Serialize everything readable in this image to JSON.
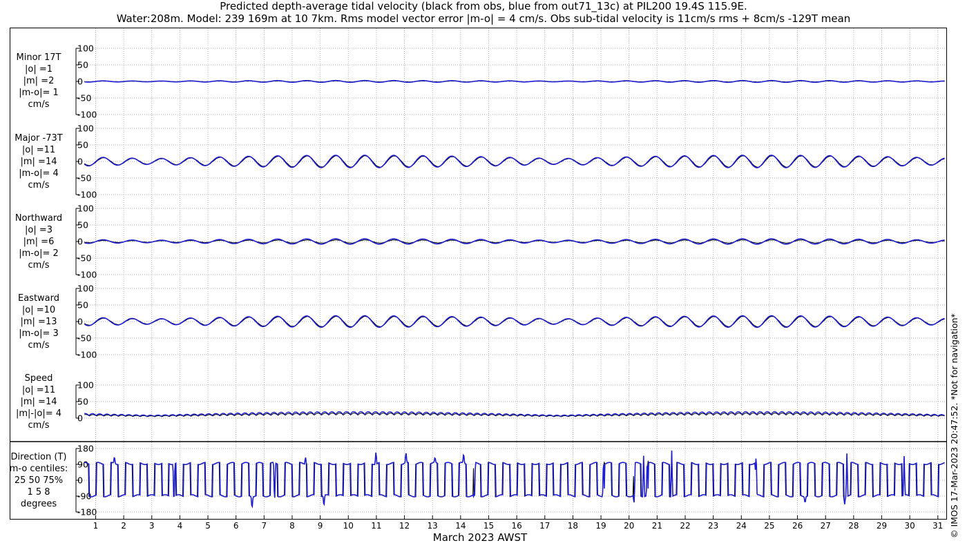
{
  "title_line1": "Predicted depth-average tidal velocity (black from obs, blue from out71_13c) at PIL200 19.4S 115.9E.",
  "title_line2": "Water:208m. Model: 239 169m at 10 7km. Rms model vector error |m-o| = 4 cm/s. Obs sub-tidal velocity is 11cm/s rms + 8cm/s -129T mean",
  "copyright": "© IMOS 17-Mar-2023 20:47:52. *Not for navigation*",
  "colors": {
    "obs": "#000000",
    "model": "#1f1fd0",
    "grid": "#9a9a9a"
  },
  "chart_data": {
    "type": "line",
    "xlabel": "March 2023 AWST",
    "x_ticks": [
      "1",
      "2",
      "3",
      "4",
      "5",
      "6",
      "7",
      "8",
      "9",
      "10",
      "11",
      "12",
      "13",
      "14",
      "15",
      "16",
      "17",
      "18",
      "19",
      "20",
      "21",
      "22",
      "23",
      "24",
      "25",
      "26",
      "27",
      "28",
      "29",
      "30",
      "31"
    ],
    "x_range_days": [
      0.3,
      31.3
    ],
    "grid": true,
    "series_legend": [
      "black from obs",
      "blue from out71_13c"
    ],
    "panels": [
      {
        "id": "minor",
        "labels": [
          "Minor 17T",
          "|o| =1",
          "|m| =2",
          "|m-o|= 1",
          "cm/s"
        ],
        "yticks": [
          "100",
          "50",
          "0",
          "-50",
          "-100"
        ],
        "ylim": [
          -100,
          100
        ],
        "amp_obs_cm_s": 1,
        "amp_model_cm_s": 2
      },
      {
        "id": "major",
        "labels": [
          "Major -73T",
          "|o| =11",
          "|m| =14",
          "|m-o|= 4",
          "cm/s"
        ],
        "yticks": [
          "100",
          "50",
          "0",
          "-50",
          "-100"
        ],
        "ylim": [
          -100,
          100
        ],
        "amp_obs_cm_s": 11,
        "amp_model_cm_s": 14
      },
      {
        "id": "north",
        "labels": [
          "Northward",
          "|o| =3",
          "|m| =6",
          "|m-o|= 2",
          "cm/s"
        ],
        "yticks": [
          "100",
          "50",
          "0",
          "-50",
          "-100"
        ],
        "ylim": [
          -100,
          100
        ],
        "amp_obs_cm_s": 3,
        "amp_model_cm_s": 6
      },
      {
        "id": "east",
        "labels": [
          "Eastward",
          "|o| =10",
          "|m| =13",
          "|m-o|= 3",
          "cm/s"
        ],
        "yticks": [
          "100",
          "50",
          "0",
          "-50",
          "-100"
        ],
        "ylim": [
          -100,
          100
        ],
        "amp_obs_cm_s": 10,
        "amp_model_cm_s": 13
      },
      {
        "id": "speed",
        "labels": [
          "Speed",
          "|o| =11",
          "|m| =14",
          "|m|-|o|= 4",
          "cm/s"
        ],
        "yticks": [
          "100",
          "50",
          "0"
        ],
        "ylim": [
          0,
          100
        ],
        "amp_obs_cm_s": 11,
        "amp_model_cm_s": 14
      },
      {
        "id": "direction",
        "labels": [
          "Direction (T)",
          "m-o centiles:",
          "25  50  75%",
          "1   5   8",
          "degrees"
        ],
        "yticks": [
          "180",
          "90",
          "0",
          "-90",
          "-180"
        ],
        "ylim": [
          -180,
          180
        ],
        "direction_levels_deg": [
          95,
          -88
        ]
      }
    ]
  }
}
